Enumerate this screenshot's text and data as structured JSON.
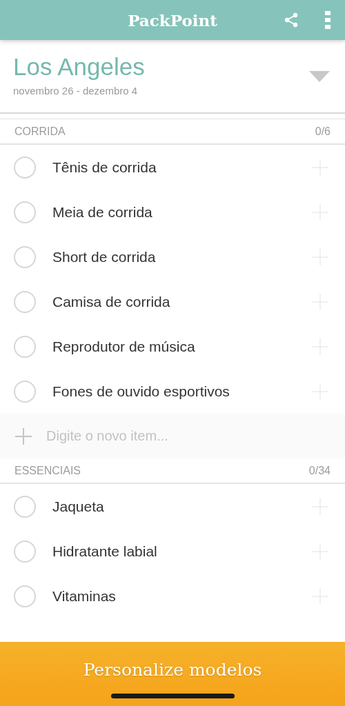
{
  "app_bar": {
    "title": "PackPoint"
  },
  "trip": {
    "city": "Los Angeles",
    "dates": "novembro 26 - dezembro 4"
  },
  "sections": [
    {
      "title": "CORRIDA",
      "count": "0/6",
      "items": [
        {
          "label": "Tênis de corrida",
          "checked": false
        },
        {
          "label": "Meia de corrida",
          "checked": false
        },
        {
          "label": "Short de corrida",
          "checked": false
        },
        {
          "label": "Camisa de corrida",
          "checked": false
        },
        {
          "label": "Reprodutor de música",
          "checked": false
        },
        {
          "label": "Fones de ouvido esportivos",
          "checked": false
        }
      ],
      "new_item": {
        "placeholder": "Digite o novo item..."
      }
    },
    {
      "title": "ESSENCIAIS",
      "count": "0/34",
      "items": [
        {
          "label": "Jaqueta",
          "checked": false
        },
        {
          "label": "Hidratante labial",
          "checked": false
        },
        {
          "label": "Vitaminas",
          "checked": false
        }
      ]
    }
  ],
  "bottom_button": "Personalize modelos"
}
